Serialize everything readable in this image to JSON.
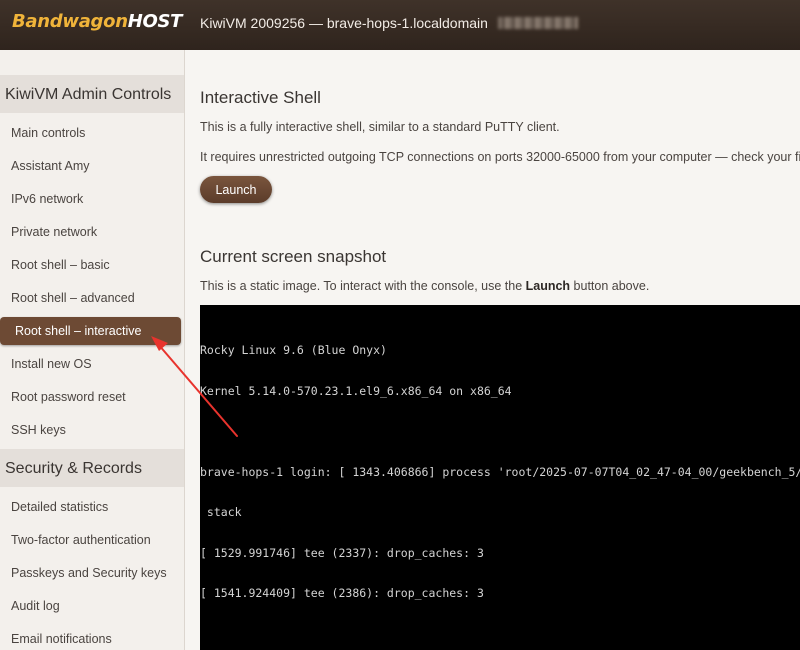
{
  "header": {
    "logo_part1": "Bandwagon",
    "logo_part2": "HOST",
    "vm_title": "KiwiVM 2009256 — brave-hops-1.localdomain"
  },
  "sidebar": {
    "section1": "KiwiVM Admin Controls",
    "items1": [
      "Main controls",
      "Assistant Amy",
      "IPv6 network",
      "Private network",
      "Root shell – basic",
      "Root shell – advanced",
      "Root shell – interactive",
      "Install new OS",
      "Root password reset",
      "SSH keys"
    ],
    "section2": "Security & Records",
    "items2": [
      "Detailed statistics",
      "Two-factor authentication",
      "Passkeys and Security keys",
      "Audit log",
      "Email notifications"
    ],
    "active_item": "Root shell – interactive"
  },
  "main": {
    "shell_heading": "Interactive Shell",
    "shell_desc": "This is a fully interactive shell, similar to a standard PuTTY client.",
    "shell_req": "It requires unrestricted outgoing TCP connections on ports 32000-65000 from your computer — check your firewall i",
    "launch_label": "Launch",
    "snapshot_heading": "Current screen snapshot",
    "snapshot_desc_pre": "This is a static image. To interact with the console, use the ",
    "snapshot_desc_bold": "Launch",
    "snapshot_desc_post": " button above."
  },
  "console": {
    "lines": [
      "Rocky Linux 9.6 (Blue Onyx)",
      "Kernel 5.14.0-570.23.1.el9_6.x86_64 on x86_64",
      "",
      "brave-hops-1 login: [ 1343.406866] process 'root/2025-07-07T04_02_47-04_00/geekbench_5/geek",
      " stack",
      "[ 1529.991746] tee (2337): drop_caches: 3",
      "[ 1541.924409] tee (2386): drop_caches: 3"
    ]
  },
  "colors": {
    "header_bg": "#35291f",
    "logo_orange": "#f0b43a",
    "active_item_bg": "#6d4a34",
    "button_bg": "#6a4733",
    "annotation_arrow": "#e8332d"
  }
}
